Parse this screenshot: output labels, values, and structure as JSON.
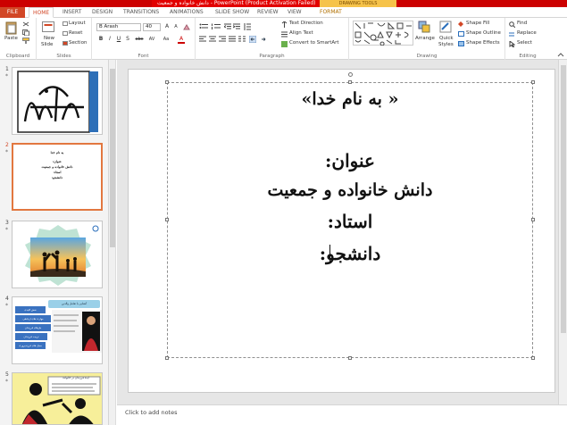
{
  "window": {
    "title": "دانش خانواده و جمعیت - PowerPoint (Product Activation Failed)",
    "context_tab_group": "DRAWING TOOLS"
  },
  "tabs": [
    "FILE",
    "HOME",
    "INSERT",
    "DESIGN",
    "TRANSITIONS",
    "ANIMATIONS",
    "SLIDE SHOW",
    "REVIEW",
    "VIEW",
    "FORMAT"
  ],
  "ribbon": {
    "clipboard": {
      "label": "Clipboard",
      "paste": "Paste"
    },
    "slides": {
      "label": "Slides",
      "new_slide": "New",
      "new_slide2": "Slide",
      "layout": "Layout",
      "reset": "Reset",
      "section": "Section"
    },
    "font": {
      "label": "Font",
      "font_name": "B Arash",
      "font_size": "40",
      "bold": "B",
      "italic": "I",
      "underline": "U",
      "strike": "S",
      "shadow": "abc",
      "spacing": "AV",
      "case": "Aa",
      "color": "A"
    },
    "paragraph": {
      "label": "Paragraph",
      "text_direction": "Text Direction",
      "align_text": "Align Text",
      "convert_smartart": "Convert to SmartArt"
    },
    "drawing": {
      "label": "Drawing",
      "arrange": "Arrange",
      "quick_styles": "Quick",
      "quick_styles2": "Styles",
      "shape_fill": "Shape Fill",
      "shape_outline": "Shape Outline",
      "shape_effects": "Shape Effects"
    },
    "editing": {
      "label": "Editing",
      "find": "Find",
      "replace": "Replace",
      "select": "Select"
    }
  },
  "thumbnails": [
    {
      "num": "1",
      "star": "*"
    },
    {
      "num": "2",
      "star": "*",
      "lines": [
        "به نام خدا",
        "عنوان:",
        "دانش خانواده و جمعیت",
        "استاد:",
        "دانشجو:"
      ]
    },
    {
      "num": "3",
      "star": "*"
    },
    {
      "num": "4",
      "star": "*",
      "labels": [
        "آشنایی با تعامل والدین",
        "نقش کلیدی",
        "مهارت های ارتباطی",
        "نیازهای فرزندان",
        "تربیت فرزندان",
        "سبک های فرزندپروری"
      ]
    },
    {
      "num": "5",
      "star": "*",
      "labels": [
        "ایده فرزندان در خانواده"
      ]
    }
  ],
  "slide": {
    "line1": "« به نام خدا»",
    "line2": "عنوان:",
    "line3": "دانش خانواده و جمعیت",
    "line4": "استاد:",
    "line5": "دانشجو:"
  },
  "notes_placeholder": "Click to add notes",
  "colors": {
    "accent": "#d24726",
    "title_bar": "#cc0000",
    "selected_thumb": "#e2773f"
  }
}
